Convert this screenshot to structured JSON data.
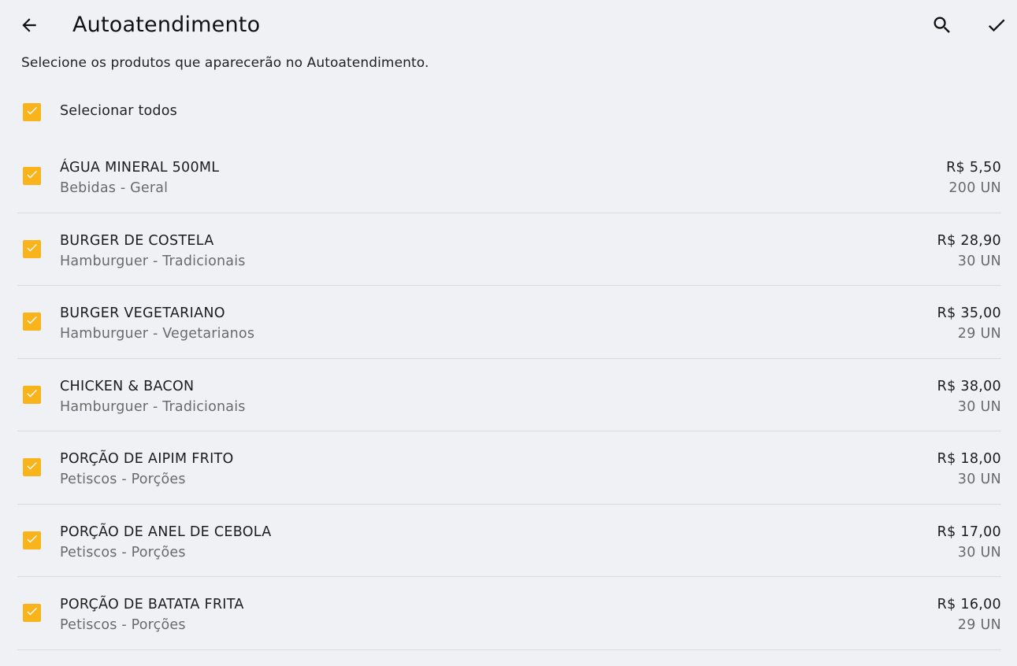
{
  "header": {
    "title": "Autoatendimento",
    "icons": {
      "back": "arrow-back-icon",
      "search": "search-icon",
      "confirm": "check-icon"
    }
  },
  "subtitle": "Selecione os produtos que aparecerão no Autoatendimento.",
  "select_all": {
    "label": "Selecionar todos",
    "checked": true
  },
  "colors": {
    "accent": "#f9b41c",
    "background": "#f0f1f5",
    "divider": "#d9dbe0",
    "secondary_text": "#6a6a6a"
  },
  "products": [
    {
      "name": "ÁGUA MINERAL 500ML",
      "category": "Bebidas - Geral",
      "price": "R$ 5,50",
      "stock": "200 UN",
      "checked": true
    },
    {
      "name": "BURGER DE COSTELA",
      "category": "Hamburguer - Tradicionais",
      "price": "R$ 28,90",
      "stock": "30 UN",
      "checked": true
    },
    {
      "name": "BURGER VEGETARIANO",
      "category": "Hamburguer - Vegetarianos",
      "price": "R$ 35,00",
      "stock": "29 UN",
      "checked": true
    },
    {
      "name": "CHICKEN & BACON",
      "category": "Hamburguer - Tradicionais",
      "price": "R$ 38,00",
      "stock": "30 UN",
      "checked": true
    },
    {
      "name": "PORÇÃO DE AIPIM FRITO",
      "category": "Petiscos - Porções",
      "price": "R$ 18,00",
      "stock": "30 UN",
      "checked": true
    },
    {
      "name": "PORÇÃO DE ANEL DE CEBOLA",
      "category": "Petiscos - Porções",
      "price": "R$ 17,00",
      "stock": "30 UN",
      "checked": true
    },
    {
      "name": "PORÇÃO DE BATATA FRITA",
      "category": "Petiscos - Porções",
      "price": "R$ 16,00",
      "stock": "29 UN",
      "checked": true
    }
  ]
}
